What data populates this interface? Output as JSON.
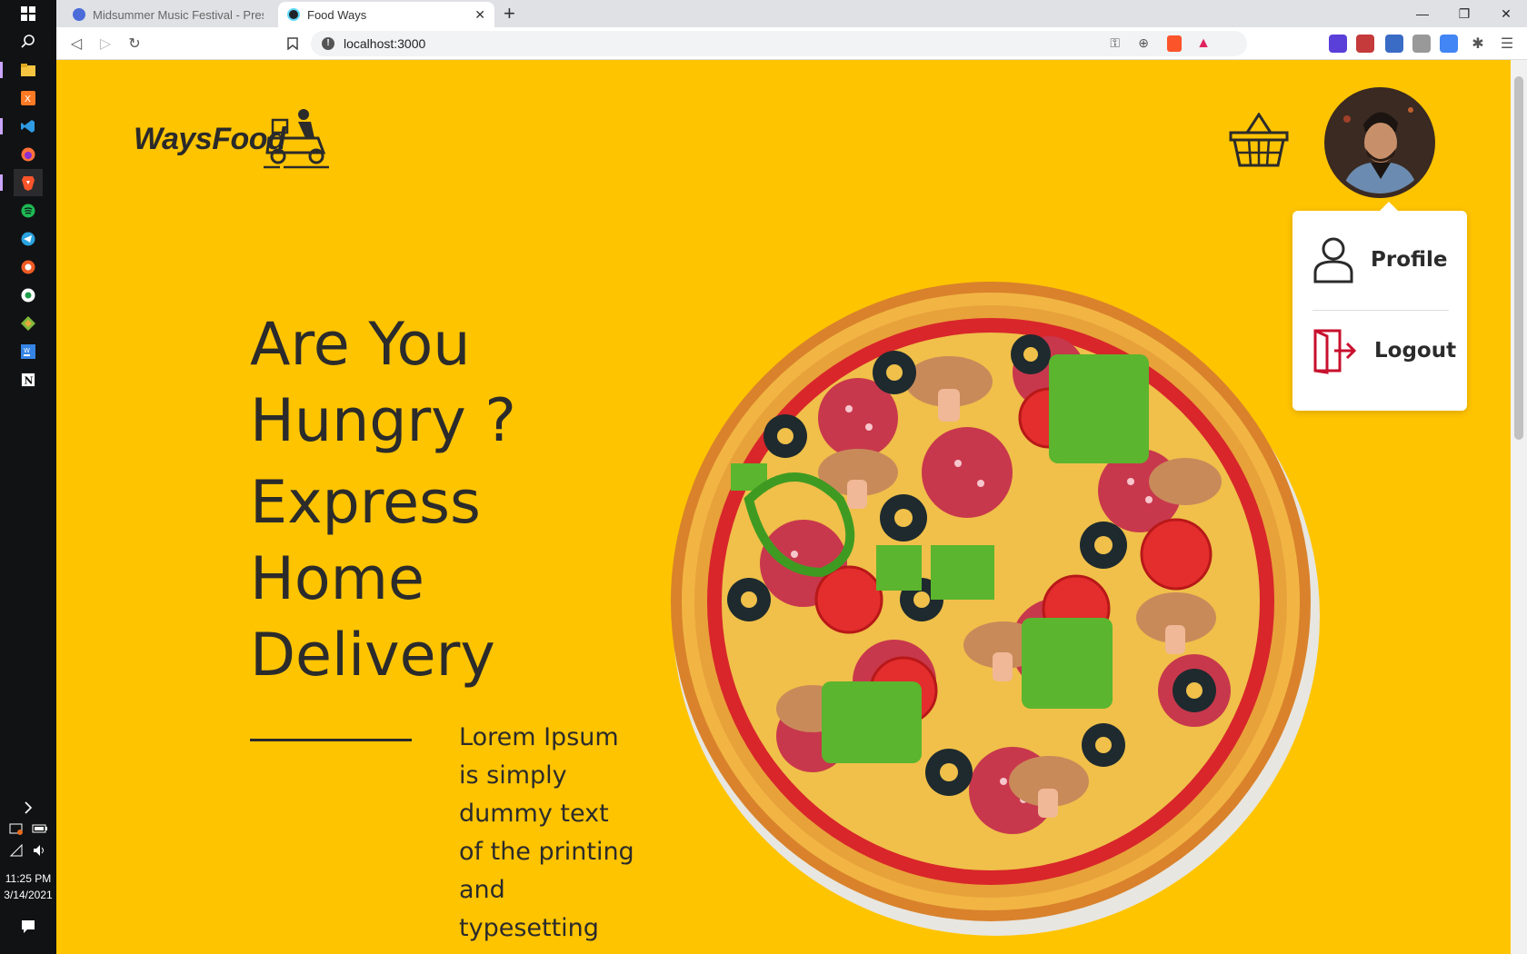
{
  "taskbar": {
    "time": "11:25 PM",
    "date": "3/14/2021",
    "apps": [
      "windows-start-icon",
      "search-icon",
      "file-explorer-icon",
      "xampp-icon",
      "vscode-icon",
      "firefox-icon",
      "brave-icon",
      "spotify-icon",
      "telegram-icon",
      "postman-icon",
      "node-icon",
      "git-icon",
      "webstorm-icon",
      "notion-icon"
    ]
  },
  "browser": {
    "tabs": [
      {
        "label": "Midsummer Music Festival - Presentation",
        "active": false
      },
      {
        "label": "Food Ways",
        "active": true
      }
    ],
    "new_tab": "+",
    "url": "localhost:3000"
  },
  "header": {
    "logo_text": "WaysFood"
  },
  "dropdown": {
    "profile_label": "Profile",
    "logout_label": "Logout"
  },
  "hero": {
    "title_lines": [
      "Are You",
      "Hungry ?"
    ],
    "subtitle_lines": [
      "Express",
      "Home",
      "Delivery"
    ],
    "description_lines": [
      "Lorem Ipsum",
      "is simply",
      "dummy text",
      "of the printing",
      "and",
      "typesetting"
    ]
  },
  "colors": {
    "page_bg": "#ffc400",
    "text_dark": "#2b2b2b",
    "logout_red": "#c8102e"
  }
}
